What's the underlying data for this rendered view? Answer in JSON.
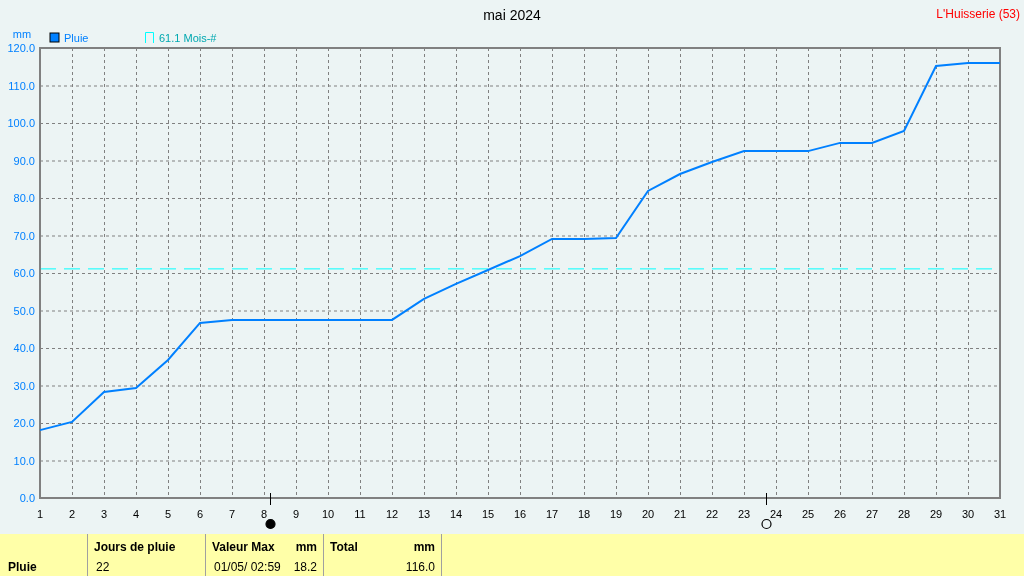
{
  "station": "L'Huisserie (53)",
  "chart": {
    "chart_data": {
      "type": "line",
      "title": "mai 2024",
      "ylabel": "mm",
      "x": [
        1,
        2,
        3,
        4,
        5,
        6,
        7,
        8,
        9,
        10,
        11,
        12,
        13,
        14,
        15,
        16,
        17,
        18,
        19,
        20,
        21,
        22,
        23,
        24,
        25,
        26,
        27,
        28,
        29,
        30,
        31
      ],
      "series": [
        {
          "name": "Pluie",
          "color": "#0080ff",
          "values": [
            18.1,
            20.3,
            28.3,
            29.3,
            36.8,
            46.7,
            47.5,
            47.5,
            47.5,
            47.5,
            47.5,
            47.5,
            53.1,
            57.1,
            60.8,
            64.5,
            69.1,
            69.1,
            69.3,
            81.9,
            86.4,
            89.6,
            92.5,
            92.5,
            92.5,
            94.7,
            94.7,
            97.9,
            115.2,
            116.0,
            116.0
          ]
        }
      ],
      "xlim": [
        1,
        31
      ],
      "ylim": [
        0,
        120
      ],
      "xticks": [
        1,
        2,
        3,
        4,
        5,
        6,
        7,
        8,
        9,
        10,
        11,
        12,
        13,
        14,
        15,
        16,
        17,
        18,
        19,
        20,
        21,
        22,
        23,
        24,
        25,
        26,
        27,
        28,
        29,
        30,
        31
      ],
      "yticks": [
        {
          "value": 0,
          "label": "0.0"
        },
        {
          "value": 10,
          "label": "10.0"
        },
        {
          "value": 20,
          "label": "20.0"
        },
        {
          "value": 30,
          "label": "30.0"
        },
        {
          "value": 40,
          "label": "40.0"
        },
        {
          "value": 50,
          "label": "50.0"
        },
        {
          "value": 60,
          "label": "60.0"
        },
        {
          "value": 70,
          "label": "70.0"
        },
        {
          "value": 80,
          "label": "80.0"
        },
        {
          "value": 90,
          "label": "90.0"
        },
        {
          "value": 100,
          "label": "100.0"
        },
        {
          "value": 110,
          "label": "110.0"
        },
        {
          "value": 120,
          "label": "120.0"
        }
      ],
      "grid": true,
      "legend": true,
      "ref_lines": [
        {
          "axis": "y",
          "value": 61.1,
          "label": "61.1 Mois-#",
          "color": "#00ffff"
        }
      ]
    }
  },
  "moon_markers": [
    {
      "kind": "full"
    },
    {
      "kind": "new"
    }
  ],
  "summary": {
    "row_label": "Pluie",
    "cells": [
      {
        "heading": "Jours de pluie",
        "values": [
          "22"
        ]
      },
      {
        "heading": "Valeur Max",
        "unit": "mm",
        "values": [
          "01/05/  02:59",
          "18.2"
        ]
      },
      {
        "heading": "Total",
        "unit": "mm",
        "values": [
          "116.0"
        ]
      }
    ]
  }
}
